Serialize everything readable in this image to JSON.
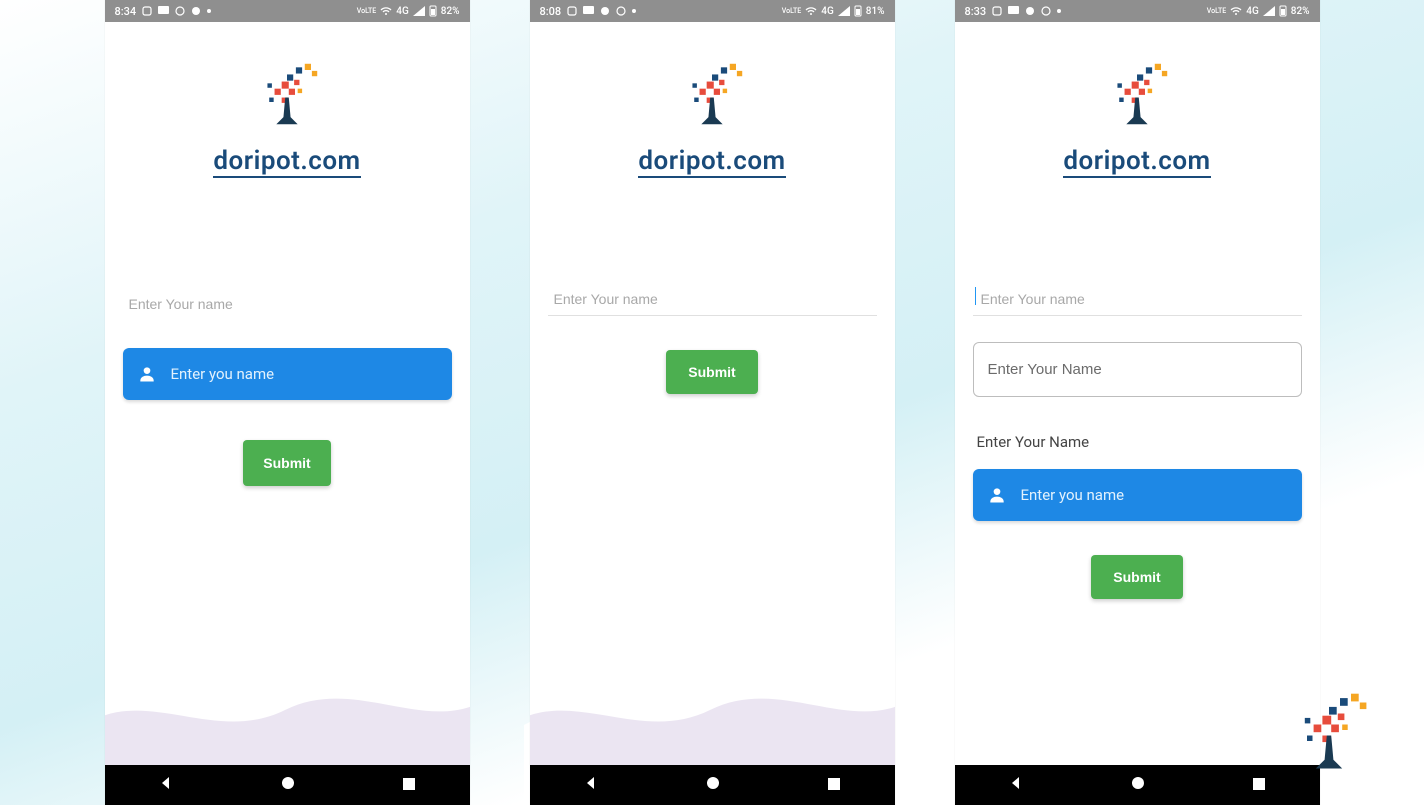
{
  "brand": "doripot.com",
  "screens": [
    {
      "status": {
        "time": "8:34",
        "network": "4G",
        "battery": "82%"
      },
      "input1_placeholder": "Enter Your name",
      "filled_placeholder": "Enter you name",
      "submit_label": "Submit"
    },
    {
      "status": {
        "time": "8:08",
        "network": "4G",
        "battery": "81%"
      },
      "input1_placeholder": "Enter Your name",
      "submit_label": "Submit"
    },
    {
      "status": {
        "time": "8:33",
        "network": "4G",
        "battery": "82%"
      },
      "input1_placeholder": "Enter Your name",
      "outlined_placeholder": "Enter Your Name",
      "plain_label": "Enter Your Name",
      "filled_placeholder": "Enter you name",
      "submit_label": "Submit"
    }
  ]
}
